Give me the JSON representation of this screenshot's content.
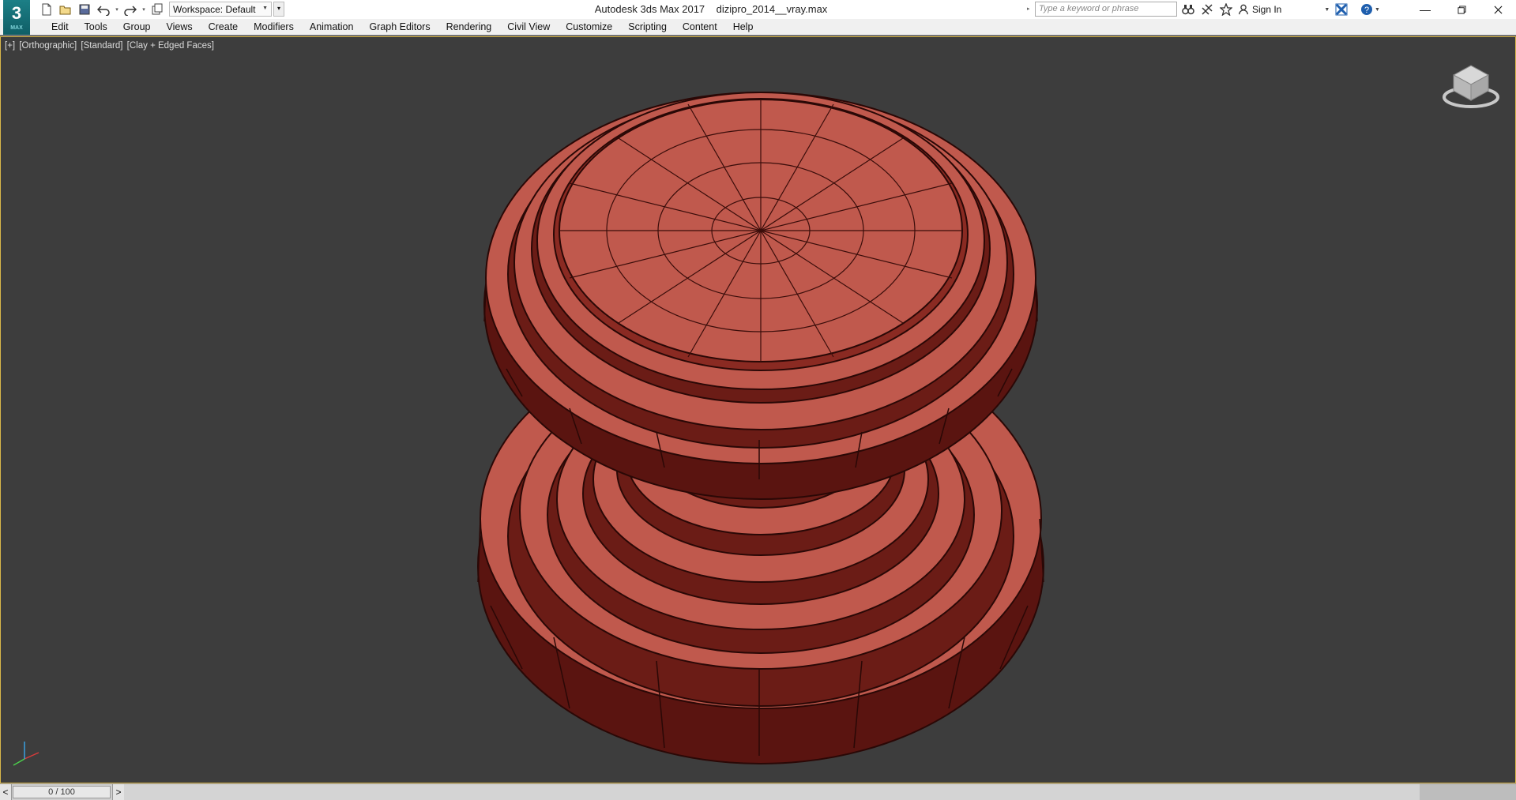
{
  "app": {
    "logo_text": "3",
    "logo_sub": "MAX",
    "window_title": "Autodesk 3ds Max 2017",
    "file_name": "dizipro_2014__vray.max"
  },
  "toolbar": {
    "workspace_label": "Workspace: Default",
    "search_placeholder": "Type a keyword or phrase",
    "sign_in_label": "Sign In"
  },
  "menu": {
    "items": [
      "Edit",
      "Tools",
      "Group",
      "Views",
      "Create",
      "Modifiers",
      "Animation",
      "Graph Editors",
      "Rendering",
      "Civil View",
      "Customize",
      "Scripting",
      "Content",
      "Help"
    ]
  },
  "viewport": {
    "label_parts": [
      "[+]",
      "[Orthographic]",
      "[Standard]",
      "[Clay + Edged Faces]"
    ],
    "model_color": "#c0594d",
    "model_edge_color": "#3a0d0a",
    "background_color": "#3d3d3d",
    "border_color": "#d8b64a"
  },
  "timeline": {
    "frame_readout": "0 / 100",
    "prev_label": "<",
    "next_label": ">"
  }
}
